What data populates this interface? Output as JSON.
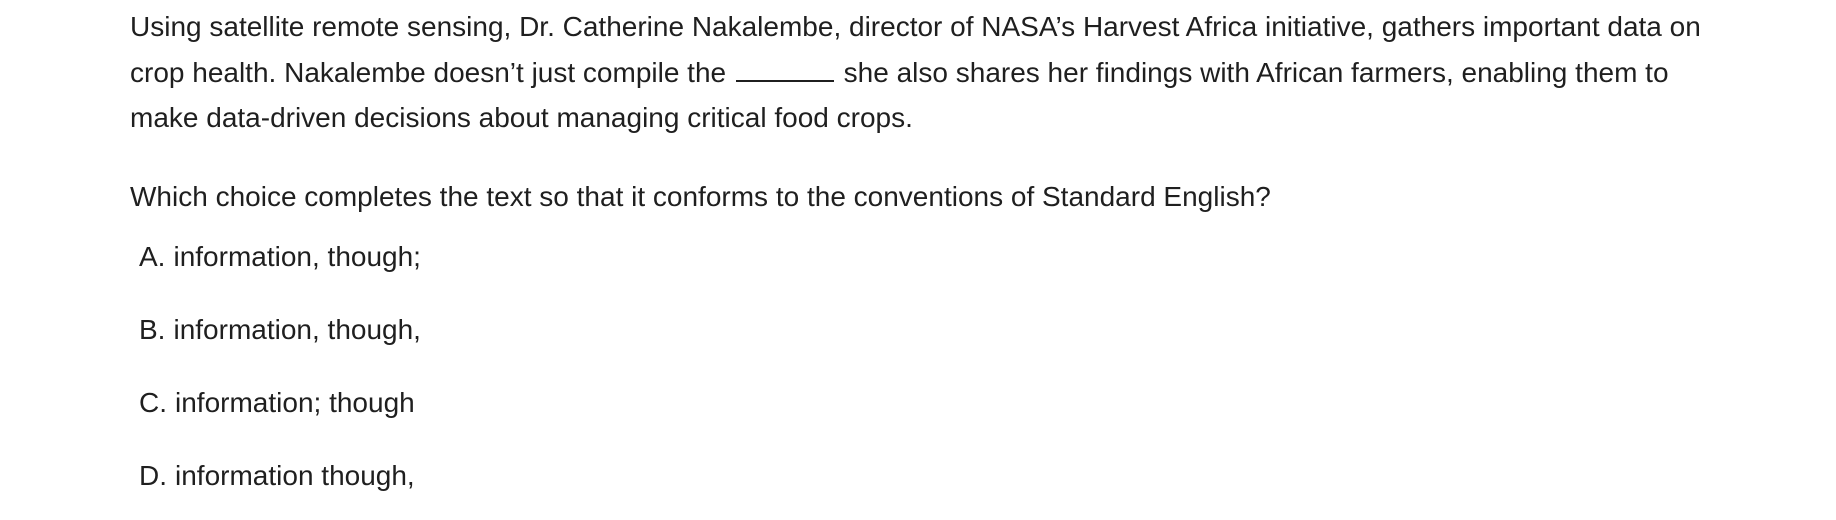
{
  "passage": {
    "before_blank": "Using satellite remote sensing, Dr. Catherine Nakalembe, director of NASA’s Harvest Africa initiative, gathers important data on crop health. Nakalembe doesn’t just compile the",
    "after_blank": "she also shares her findings with African farmers, enabling them to make data-driven decisions about managing critical food crops."
  },
  "question": {
    "text": "Which choice completes the text so that it conforms to the conventions of Standard English?"
  },
  "choices": [
    {
      "letter": "A.",
      "text": "information, though;"
    },
    {
      "letter": "B.",
      "text": "information, though,"
    },
    {
      "letter": "C.",
      "text": "information; though"
    },
    {
      "letter": "D.",
      "text": "information though,"
    }
  ]
}
